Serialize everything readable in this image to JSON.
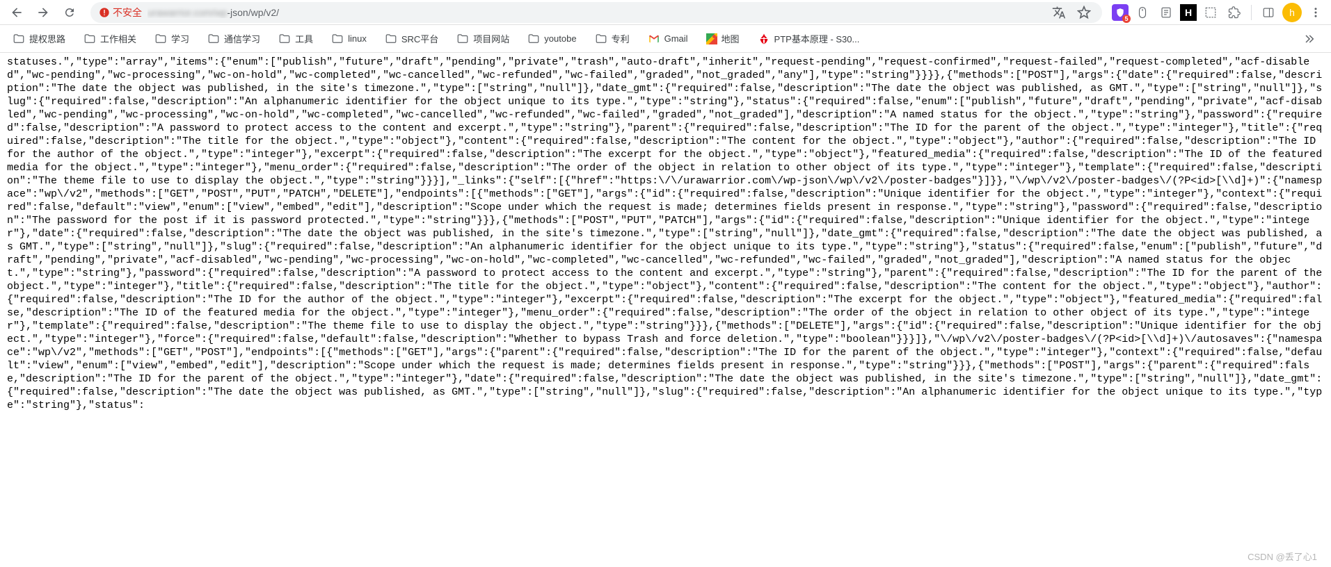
{
  "toolbar": {
    "insecure_label": "不安全",
    "url_visible_suffix": "-json/wp/v2/",
    "url_hidden_prefix": "urawarrior.com/wp"
  },
  "ext": {
    "badge": "5",
    "h": "H"
  },
  "avatar": {
    "letter": "h"
  },
  "bookmarks": [
    {
      "label": "提权思路",
      "type": "folder"
    },
    {
      "label": "工作相关",
      "type": "folder"
    },
    {
      "label": "学习",
      "type": "folder"
    },
    {
      "label": "通信学习",
      "type": "folder"
    },
    {
      "label": "工具",
      "type": "folder"
    },
    {
      "label": "linux",
      "type": "folder"
    },
    {
      "label": "SRC平台",
      "type": "folder"
    },
    {
      "label": "项目网站",
      "type": "folder"
    },
    {
      "label": "youtobe",
      "type": "folder"
    },
    {
      "label": "专利",
      "type": "folder"
    },
    {
      "label": "Gmail",
      "type": "gmail"
    },
    {
      "label": "地图",
      "type": "map"
    },
    {
      "label": "PTP基本原理 - S30...",
      "type": "huawei"
    }
  ],
  "watermark": "CSDN @丢了心1",
  "json_body": "statuses.\",\"type\":\"array\",\"items\":{\"enum\":[\"publish\",\"future\",\"draft\",\"pending\",\"private\",\"trash\",\"auto-draft\",\"inherit\",\"request-pending\",\"request-confirmed\",\"request-failed\",\"request-completed\",\"acf-disabled\",\"wc-pending\",\"wc-processing\",\"wc-on-hold\",\"wc-completed\",\"wc-cancelled\",\"wc-refunded\",\"wc-failed\",\"graded\",\"not_graded\",\"any\"],\"type\":\"string\"}}}},{\"methods\":[\"POST\"],\"args\":{\"date\":{\"required\":false,\"description\":\"The date the object was published, in the site's timezone.\",\"type\":[\"string\",\"null\"]},\"date_gmt\":{\"required\":false,\"description\":\"The date the object was published, as GMT.\",\"type\":[\"string\",\"null\"]},\"slug\":{\"required\":false,\"description\":\"An alphanumeric identifier for the object unique to its type.\",\"type\":\"string\"},\"status\":{\"required\":false,\"enum\":[\"publish\",\"future\",\"draft\",\"pending\",\"private\",\"acf-disabled\",\"wc-pending\",\"wc-processing\",\"wc-on-hold\",\"wc-completed\",\"wc-cancelled\",\"wc-refunded\",\"wc-failed\",\"graded\",\"not_graded\"],\"description\":\"A named status for the object.\",\"type\":\"string\"},\"password\":{\"required\":false,\"description\":\"A password to protect access to the content and excerpt.\",\"type\":\"string\"},\"parent\":{\"required\":false,\"description\":\"The ID for the parent of the object.\",\"type\":\"integer\"},\"title\":{\"required\":false,\"description\":\"The title for the object.\",\"type\":\"object\"},\"content\":{\"required\":false,\"description\":\"The content for the object.\",\"type\":\"object\"},\"author\":{\"required\":false,\"description\":\"The ID for the author of the object.\",\"type\":\"integer\"},\"excerpt\":{\"required\":false,\"description\":\"The excerpt for the object.\",\"type\":\"object\"},\"featured_media\":{\"required\":false,\"description\":\"The ID of the featured media for the object.\",\"type\":\"integer\"},\"menu_order\":{\"required\":false,\"description\":\"The order of the object in relation to other object of its type.\",\"type\":\"integer\"},\"template\":{\"required\":false,\"description\":\"The theme file to use to display the object.\",\"type\":\"string\"}}}],\"_links\":{\"self\":[{\"href\":\"https:\\/\\/urawarrior.com\\/wp-json\\/wp\\/v2\\/poster-badges\"}]}},\"\\/wp\\/v2\\/poster-badges\\/(?P<id>[\\\\d]+)\":{\"namespace\":\"wp\\/v2\",\"methods\":[\"GET\",\"POST\",\"PUT\",\"PATCH\",\"DELETE\"],\"endpoints\":[{\"methods\":[\"GET\"],\"args\":{\"id\":{\"required\":false,\"description\":\"Unique identifier for the object.\",\"type\":\"integer\"},\"context\":{\"required\":false,\"default\":\"view\",\"enum\":[\"view\",\"embed\",\"edit\"],\"description\":\"Scope under which the request is made; determines fields present in response.\",\"type\":\"string\"},\"password\":{\"required\":false,\"description\":\"The password for the post if it is password protected.\",\"type\":\"string\"}}},{\"methods\":[\"POST\",\"PUT\",\"PATCH\"],\"args\":{\"id\":{\"required\":false,\"description\":\"Unique identifier for the object.\",\"type\":\"integer\"},\"date\":{\"required\":false,\"description\":\"The date the object was published, in the site's timezone.\",\"type\":[\"string\",\"null\"]},\"date_gmt\":{\"required\":false,\"description\":\"The date the object was published, as GMT.\",\"type\":[\"string\",\"null\"]},\"slug\":{\"required\":false,\"description\":\"An alphanumeric identifier for the object unique to its type.\",\"type\":\"string\"},\"status\":{\"required\":false,\"enum\":[\"publish\",\"future\",\"draft\",\"pending\",\"private\",\"acf-disabled\",\"wc-pending\",\"wc-processing\",\"wc-on-hold\",\"wc-completed\",\"wc-cancelled\",\"wc-refunded\",\"wc-failed\",\"graded\",\"not_graded\"],\"description\":\"A named status for the object.\",\"type\":\"string\"},\"password\":{\"required\":false,\"description\":\"A password to protect access to the content and excerpt.\",\"type\":\"string\"},\"parent\":{\"required\":false,\"description\":\"The ID for the parent of the object.\",\"type\":\"integer\"},\"title\":{\"required\":false,\"description\":\"The title for the object.\",\"type\":\"object\"},\"content\":{\"required\":false,\"description\":\"The content for the object.\",\"type\":\"object\"},\"author\":{\"required\":false,\"description\":\"The ID for the author of the object.\",\"type\":\"integer\"},\"excerpt\":{\"required\":false,\"description\":\"The excerpt for the object.\",\"type\":\"object\"},\"featured_media\":{\"required\":false,\"description\":\"The ID of the featured media for the object.\",\"type\":\"integer\"},\"menu_order\":{\"required\":false,\"description\":\"The order of the object in relation to other object of its type.\",\"type\":\"integer\"},\"template\":{\"required\":false,\"description\":\"The theme file to use to display the object.\",\"type\":\"string\"}}},{\"methods\":[\"DELETE\"],\"args\":{\"id\":{\"required\":false,\"description\":\"Unique identifier for the object.\",\"type\":\"integer\"},\"force\":{\"required\":false,\"default\":false,\"description\":\"Whether to bypass Trash and force deletion.\",\"type\":\"boolean\"}}}]},\"\\/wp\\/v2\\/poster-badges\\/(?P<id>[\\\\d]+)\\/autosaves\":{\"namespace\":\"wp\\/v2\",\"methods\":[\"GET\",\"POST\"],\"endpoints\":[{\"methods\":[\"GET\"],\"args\":{\"parent\":{\"required\":false,\"description\":\"The ID for the parent of the object.\",\"type\":\"integer\"},\"context\":{\"required\":false,\"default\":\"view\",\"enum\":[\"view\",\"embed\",\"edit\"],\"description\":\"Scope under which the request is made; determines fields present in response.\",\"type\":\"string\"}}},{\"methods\":[\"POST\"],\"args\":{\"parent\":{\"required\":false,\"description\":\"The ID for the parent of the object.\",\"type\":\"integer\"},\"date\":{\"required\":false,\"description\":\"The date the object was published, in the site's timezone.\",\"type\":[\"string\",\"null\"]},\"date_gmt\":{\"required\":false,\"description\":\"The date the object was published, as GMT.\",\"type\":[\"string\",\"null\"]},\"slug\":{\"required\":false,\"description\":\"An alphanumeric identifier for the object unique to its type.\",\"type\":\"string\"},\"status\":"
}
